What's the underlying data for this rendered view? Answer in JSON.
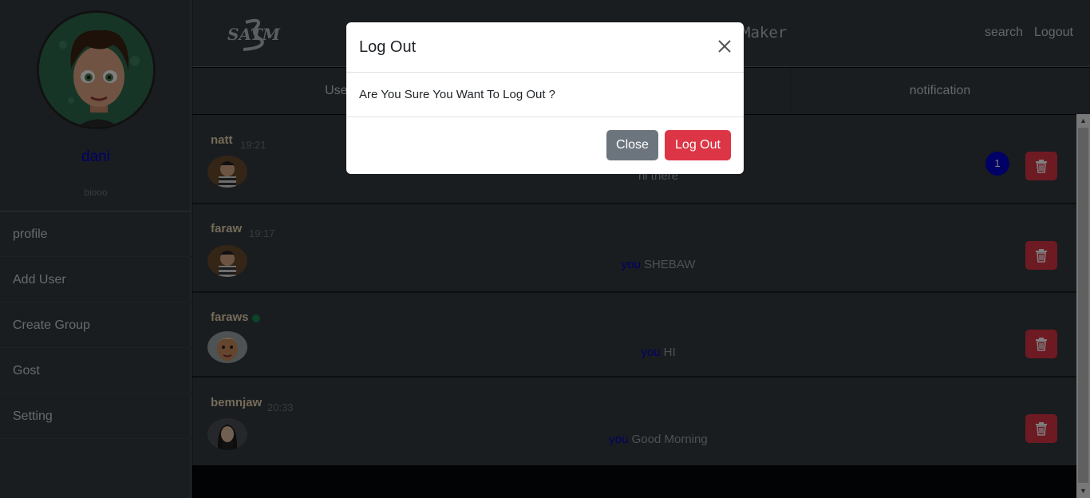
{
  "sidebar": {
    "user_name": "dani",
    "user_bio": "biooo",
    "menu": [
      {
        "label": "profile"
      },
      {
        "label": "Add User"
      },
      {
        "label": "Create Group"
      },
      {
        "label": "Gost"
      },
      {
        "label": "Setting"
      }
    ]
  },
  "topnav": {
    "brand_visible": "Maker",
    "search_label": "search",
    "logout_label": "Logout"
  },
  "tabs": [
    {
      "label": "Users"
    },
    {
      "label": ""
    },
    {
      "label": "notification"
    }
  ],
  "chats": [
    {
      "name": "natt",
      "time": "19:21",
      "prefix": "",
      "message": "hi there",
      "unread": "1",
      "online": false
    },
    {
      "name": "faraw",
      "time": "19:17",
      "prefix": "you",
      "message": "SHEBAW",
      "unread": "",
      "online": false
    },
    {
      "name": "faraws",
      "time": "",
      "prefix": "you",
      "message": "HI",
      "unread": "",
      "online": true
    },
    {
      "name": "bemnjaw",
      "time": "20:33",
      "prefix": "you",
      "message": "Good Morning",
      "unread": "",
      "online": false
    }
  ],
  "modal": {
    "title": "Log Out",
    "body": "Are You Sure You Want To Log Out ?",
    "close_label": "Close",
    "confirm_label": "Log Out"
  },
  "colors": {
    "sidebar_bg": "#343a40",
    "accent_blue": "#0000cc",
    "danger": "#dc3545",
    "secondary": "#6c757d"
  }
}
